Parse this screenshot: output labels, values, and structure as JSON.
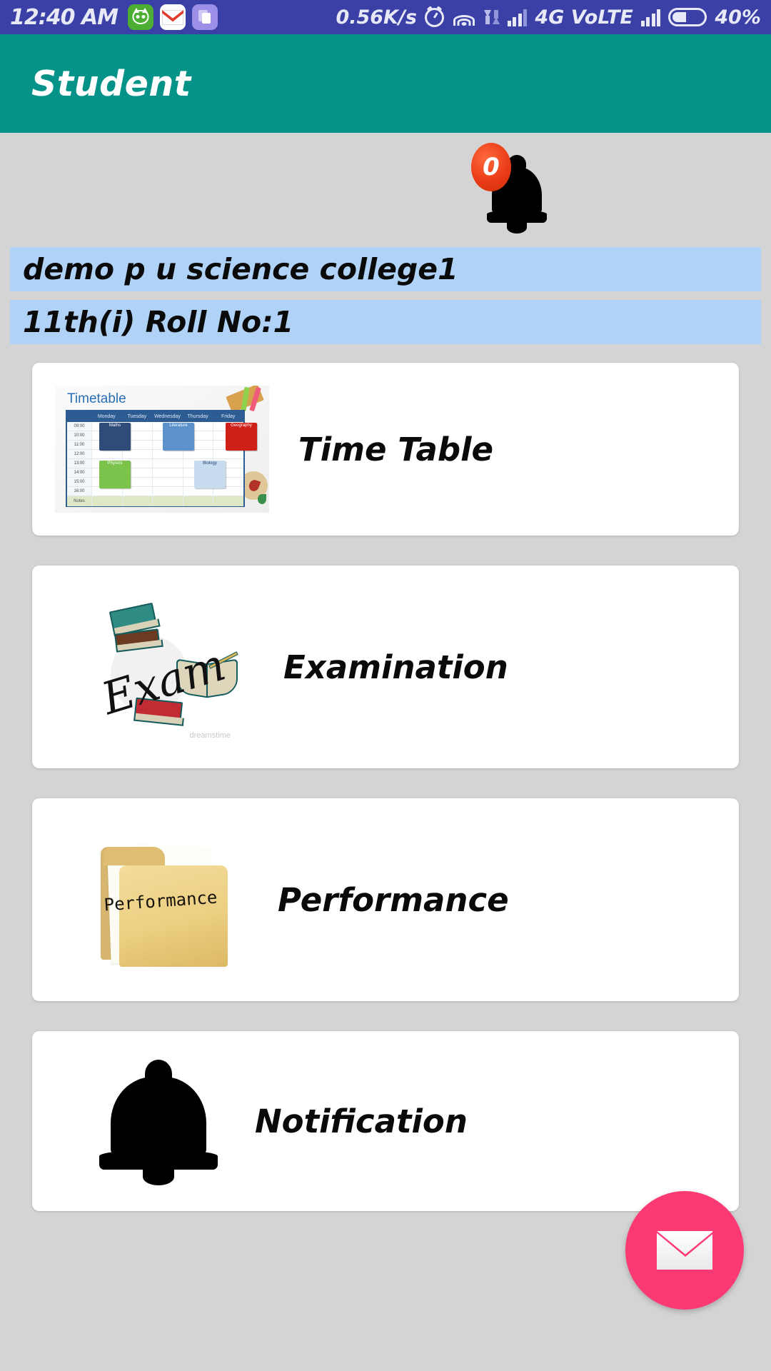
{
  "statusbar": {
    "clock": "12:40 AM",
    "net_speed": "0.56K/s",
    "network_type": "4G VoLTE",
    "battery_percent": "40%",
    "app_icons": [
      "cat-app-icon",
      "gmail-icon",
      "purple-app-icon"
    ],
    "indicators": [
      "alarm-icon",
      "wifi-icon",
      "data-transfer-icon",
      "signal-icon",
      "signal-icon-2",
      "battery-icon"
    ]
  },
  "appbar": {
    "title": "Student",
    "color": "#059389"
  },
  "notification_bell": {
    "badge_count": "0",
    "badge_color": "#ea3c16"
  },
  "info": {
    "college": "demo p u science college1",
    "class_roll": "11th(i) Roll No:1",
    "bar_color": "#b1d2f7"
  },
  "cards": [
    {
      "label": "Time Table",
      "icon": "timetable-thumbnail"
    },
    {
      "label": "Examination",
      "icon": "exam-books-thumbnail"
    },
    {
      "label": "Performance",
      "icon": "performance-folder-thumbnail"
    },
    {
      "label": "Notification",
      "icon": "bell-icon"
    }
  ],
  "timetable_art": {
    "title": "Timetable",
    "days": [
      "",
      "Monday",
      "Tuesday",
      "Wednesday",
      "Thursday",
      "Friday"
    ],
    "times": [
      "09:00",
      "10:00",
      "11:00",
      "12:00",
      "13:00",
      "14:00",
      "15:00",
      "16:00"
    ],
    "notes_label": "Notes",
    "subjects": [
      "Maths",
      "Literature",
      "Geography",
      "Physics",
      "Biology"
    ]
  },
  "exam_art": {
    "word": "Exam",
    "credit": "dreamstime"
  },
  "performance_art": {
    "folder_text": "Performance"
  },
  "fab": {
    "icon": "envelope-icon",
    "color": "#fb3a74"
  }
}
